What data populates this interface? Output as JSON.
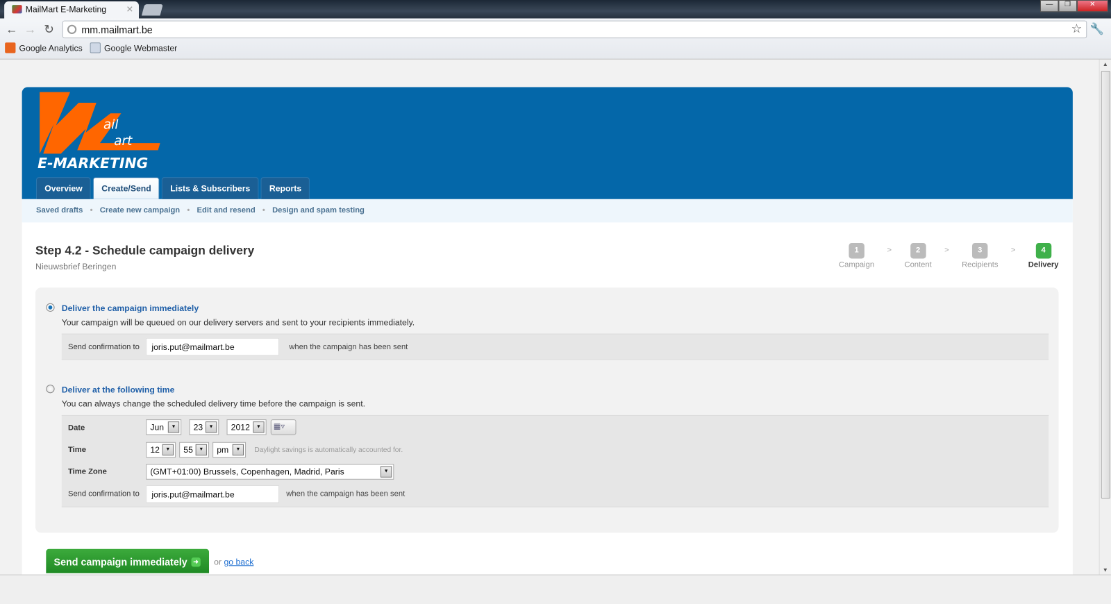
{
  "browser": {
    "tab_title": "MailMart E-Marketing",
    "url": "mm.mailmart.be",
    "bookmarks": [
      "Google Analytics",
      "Google Webmaster"
    ]
  },
  "logo": {
    "text_top": "ail",
    "text_mid": "art",
    "text_bottom": "E-MARKETING"
  },
  "nav": {
    "tabs": [
      "Overview",
      "Create/Send",
      "Lists & Subscribers",
      "Reports"
    ],
    "active": "Create/Send"
  },
  "subnav": [
    "Saved drafts",
    "Create new campaign",
    "Edit and resend",
    "Design and spam testing"
  ],
  "page": {
    "title": "Step 4.2 - Schedule campaign delivery",
    "subtitle": "Nieuwsbrief Beringen"
  },
  "steps": [
    {
      "n": "1",
      "label": "Campaign"
    },
    {
      "n": "2",
      "label": "Content"
    },
    {
      "n": "3",
      "label": "Recipients"
    },
    {
      "n": "4",
      "label": "Delivery",
      "active": true
    }
  ],
  "step_separator": ">",
  "immediate": {
    "label": "Deliver the campaign immediately",
    "desc": "Your campaign will be queued on our delivery servers and sent to your recipients immediately.",
    "confirm_label": "Send confirmation to",
    "email": "joris.put@mailmart.be",
    "confirm_note": "when the campaign has been sent",
    "selected": true
  },
  "scheduled": {
    "label": "Deliver at the following time",
    "desc": "You can always change the scheduled delivery time before the campaign is sent.",
    "date_label": "Date",
    "month": "Jun",
    "day": "23",
    "year": "2012",
    "time_label": "Time",
    "hour": "12",
    "minute": "55",
    "ampm": "pm",
    "dst_hint": "Daylight savings is automatically accounted for.",
    "tz_label": "Time Zone",
    "timezone": "(GMT+01:00) Brussels, Copenhagen, Madrid, Paris",
    "confirm_label": "Send confirmation to",
    "email": "joris.put@mailmart.be",
    "confirm_note": "when the campaign has been sent",
    "selected": false
  },
  "actions": {
    "send": "Send campaign immediately",
    "or": "or",
    "back": "go back"
  },
  "colors": {
    "header": "#0467a9",
    "logo_orange": "#ff6600",
    "send_green": "#2e9a30",
    "step_active": "#3fb04a"
  }
}
